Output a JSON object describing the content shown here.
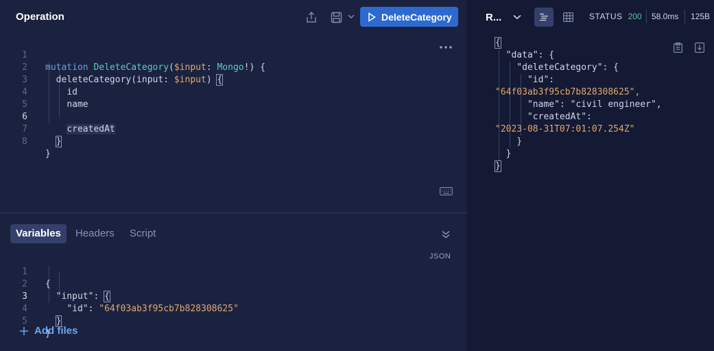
{
  "operation": {
    "title": "Operation",
    "run_button_label": "DeleteCategory",
    "line_numbers": [
      "1",
      "2",
      "3",
      "4",
      "5",
      "6",
      "7",
      "8"
    ],
    "code": {
      "l1_keyword": "mutation",
      "l1_name": "DeleteCategory",
      "l1_open": "(",
      "l1_var": "$input",
      "l1_colon": ": ",
      "l1_type": "Mongo",
      "l1_close": "!) {",
      "l2_field": "deleteCategory",
      "l2_arg": "(input: ",
      "l2_var": "$input",
      "l2_close": ") ",
      "l2_brace": "{",
      "l3_field": "id",
      "l4_field": "name",
      "l6_field": "createdAt",
      "l7_brace": "}",
      "l8_brace": "}"
    }
  },
  "variables_panel": {
    "tabs": [
      "Variables",
      "Headers",
      "Script"
    ],
    "json_label": "JSON",
    "line_numbers": [
      "1",
      "2",
      "3",
      "4",
      "5"
    ],
    "code": {
      "l1": "{",
      "l2_key": "\"input\"",
      "l2_colon": ": ",
      "l2_brace": "{",
      "l3_key": "\"id\"",
      "l3_colon": ": ",
      "l3_value": "\"64f03ab3f95cb7b828308625\"",
      "l4_brace": "}",
      "l5": "}"
    },
    "add_files_label": "Add files"
  },
  "response": {
    "tab_label": "R...",
    "status_label": "STATUS",
    "status_code": "200",
    "time": "58.0ms",
    "size": "125B",
    "lines": [
      "{",
      "  \"data\": {",
      "    \"deleteCategory\": {",
      "      \"id\":",
      "\"64f03ab3f95cb7b828308625\",",
      "      \"name\": \"civil engineer\",",
      "      \"createdAt\":",
      "\"2023-08-31T07:01:07.254Z\"",
      "    }",
      "  }",
      "}"
    ]
  },
  "colors": {
    "run_button": "#2d6ad0",
    "status_ok": "#4ec9a0",
    "link": "#6aa8f0"
  }
}
